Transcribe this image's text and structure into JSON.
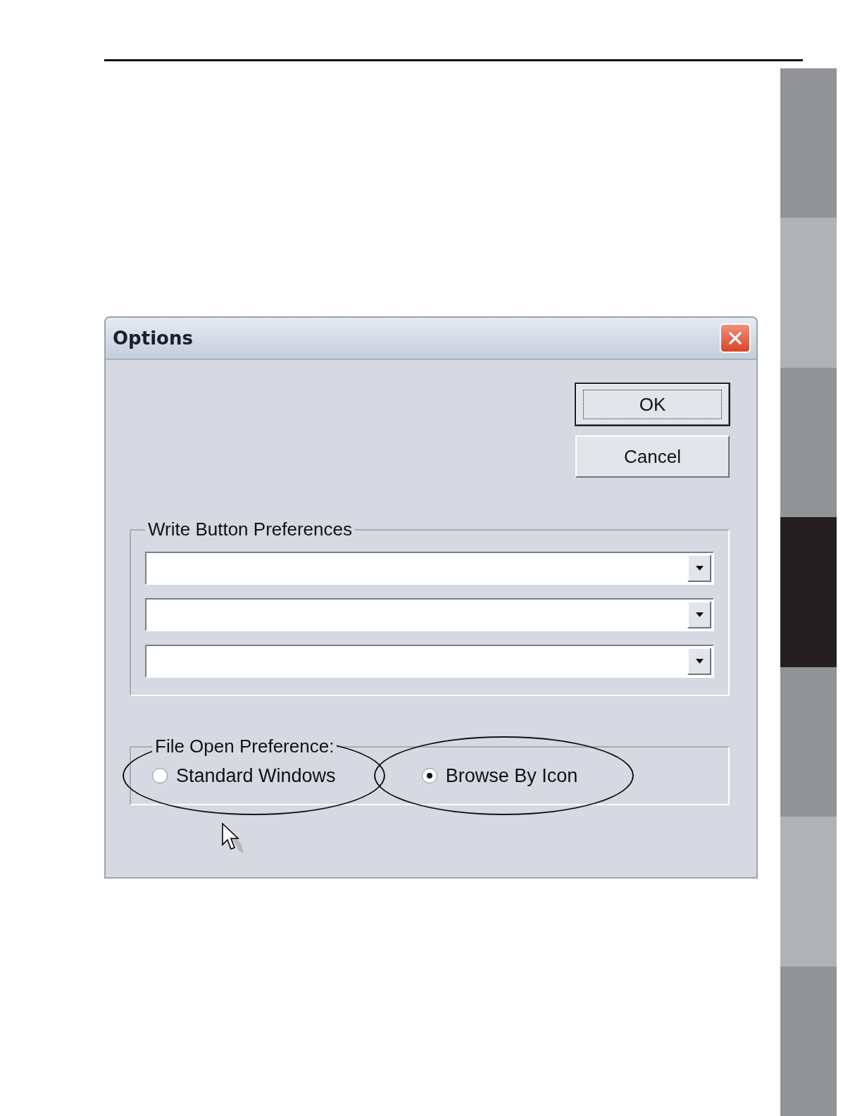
{
  "page": {
    "thumb_tabs": [
      {
        "selected": false
      },
      {
        "selected": false
      },
      {
        "selected": false
      },
      {
        "selected": true
      },
      {
        "selected": false
      },
      {
        "selected": false
      },
      {
        "selected": false
      }
    ]
  },
  "dialog": {
    "title": "Options",
    "buttons": [
      {
        "label": "OK",
        "focused": true
      },
      {
        "label": "Cancel",
        "focused": false
      }
    ],
    "write_button_preferences": {
      "title": "Write Button Preferences",
      "dropdowns": [
        {
          "kind": "dropdown"
        },
        {
          "kind": "dropdown"
        },
        {
          "kind": "dropdown"
        }
      ]
    },
    "file_open_preference": {
      "title": "File Open Preference:",
      "options": [
        {
          "label": "Standard Windows",
          "selected": false,
          "circled": true
        },
        {
          "label": "Browse By Icon",
          "selected": true,
          "circled": true
        }
      ]
    }
  }
}
